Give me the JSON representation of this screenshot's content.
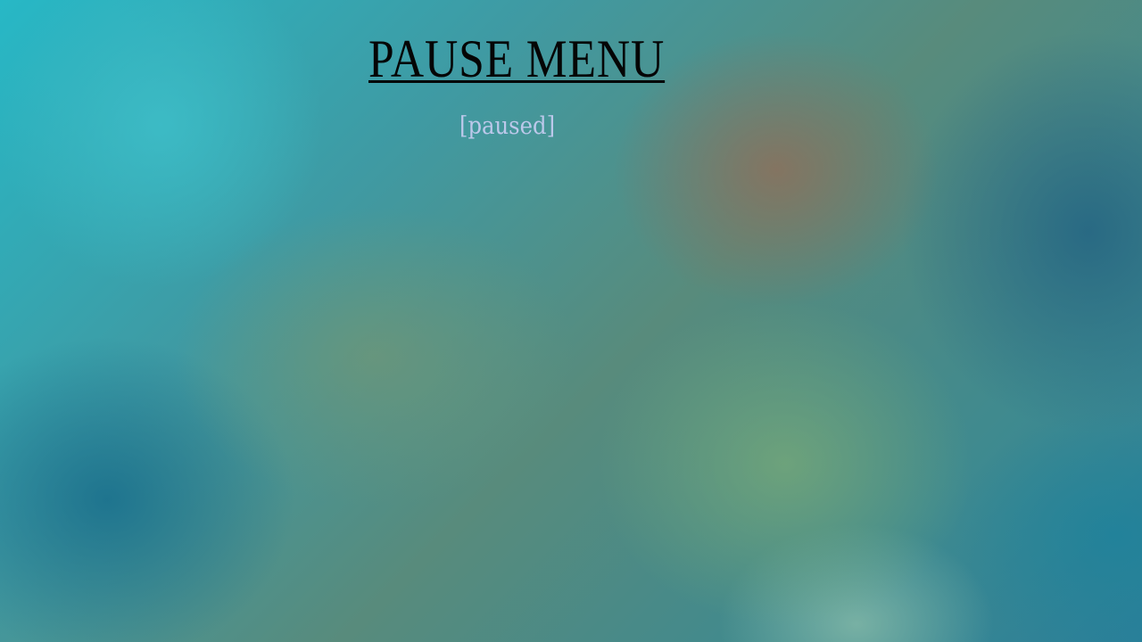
{
  "pause_menu": {
    "title": "PAUSE MENU",
    "status": "[paused]"
  }
}
